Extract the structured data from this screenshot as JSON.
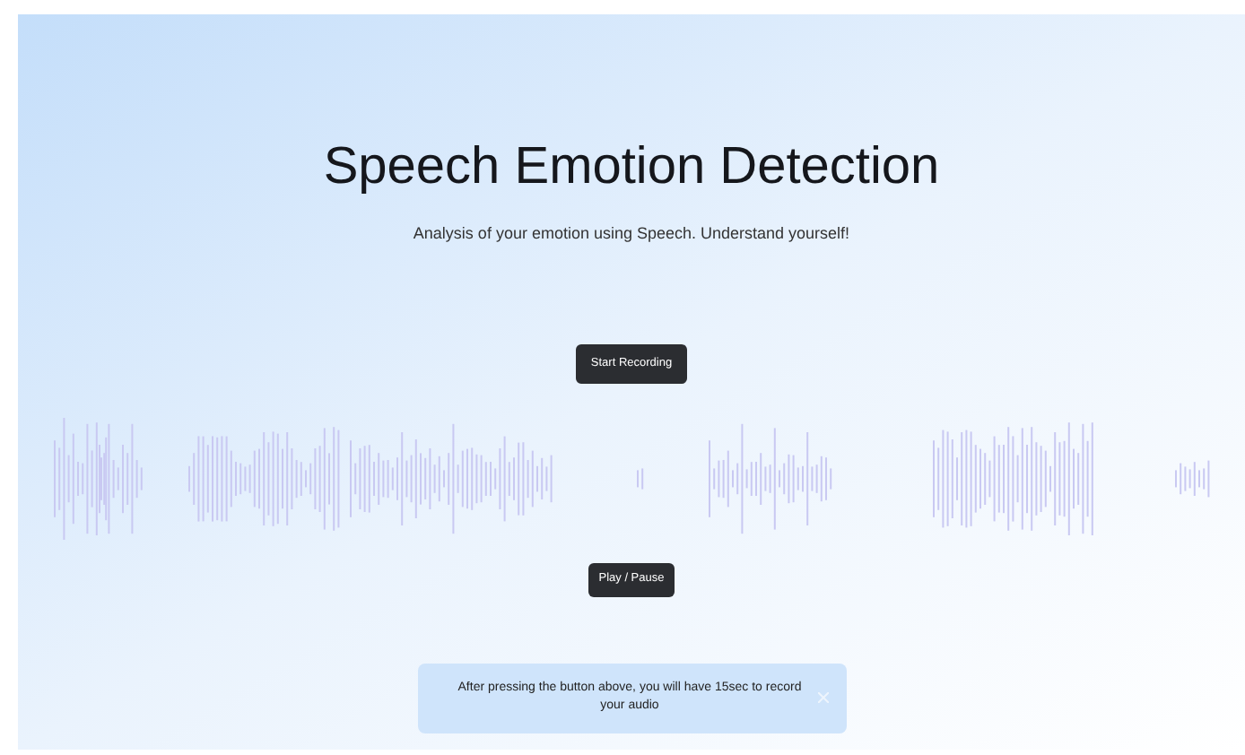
{
  "header": {
    "title": "Speech Emotion Detection",
    "subtitle": "Analysis of your emotion using Speech. Understand yourself!"
  },
  "buttons": [
    {
      "label": "Start Recording"
    },
    {
      "label": "Play / Pause"
    }
  ],
  "alert": {
    "text": "After pressing the button above, you will have 15sec to record your audio"
  }
}
